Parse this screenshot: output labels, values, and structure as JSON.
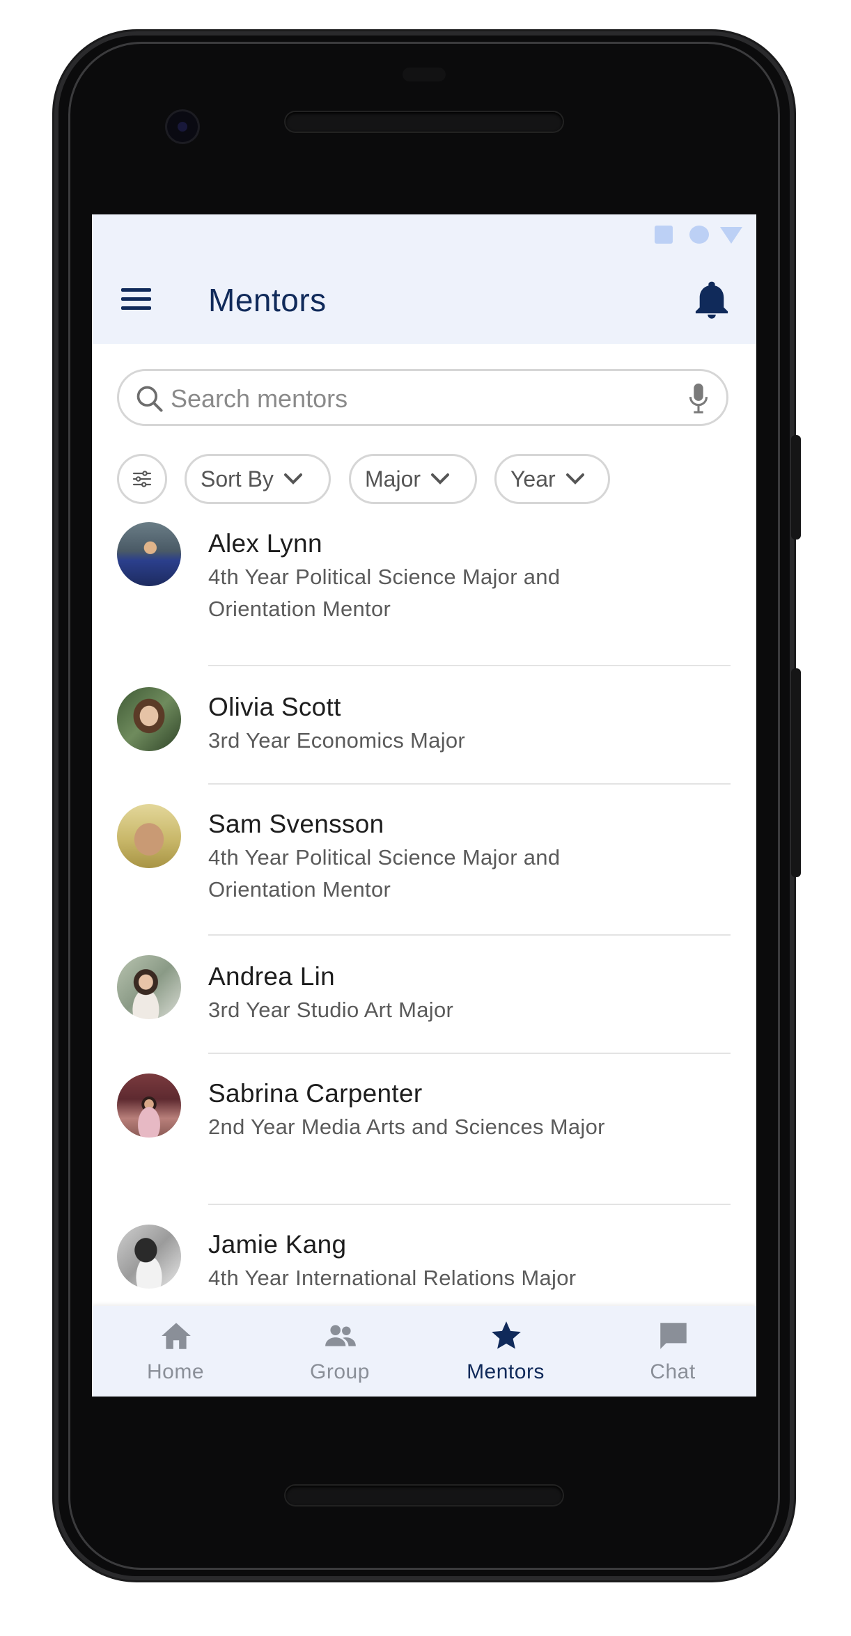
{
  "app": {
    "title": "Mentors"
  },
  "search": {
    "placeholder": "Search mentors",
    "value": ""
  },
  "filters": [
    {
      "label": "Sort By"
    },
    {
      "label": "Major"
    },
    {
      "label": "Year"
    }
  ],
  "mentors": [
    {
      "name": "Alex Lynn",
      "description": "4th Year Political Science Major and Orientation Mentor"
    },
    {
      "name": "Olivia Scott",
      "description": "3rd Year Economics Major"
    },
    {
      "name": "Sam Svensson",
      "description": "4th Year Political Science Major and Orientation Mentor"
    },
    {
      "name": "Andrea Lin",
      "description": "3rd Year Studio Art Major"
    },
    {
      "name": "Sabrina Carpenter",
      "description": "2nd Year Media Arts and Sciences Major"
    },
    {
      "name": "Jamie Kang",
      "description": "4th Year International Relations Major"
    }
  ],
  "bottom_nav": [
    {
      "label": "Home",
      "icon": "home-icon",
      "active": false
    },
    {
      "label": "Group",
      "icon": "group-icon",
      "active": false
    },
    {
      "label": "Mentors",
      "icon": "star-icon",
      "active": true
    },
    {
      "label": "Chat",
      "icon": "chat-icon",
      "active": false
    }
  ],
  "colors": {
    "primary": "#102a5a",
    "app_bar_bg": "#eef2fb",
    "status_icons": "#bcd0f5",
    "inactive_nav": "#8a8f98"
  }
}
